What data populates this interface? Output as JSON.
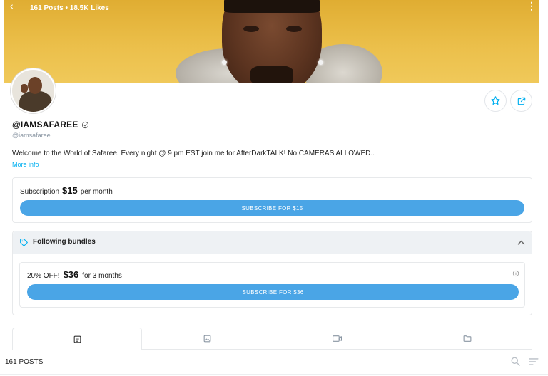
{
  "header": {
    "stats": "161 Posts • 18.5K Likes",
    "back_icon": "back-arrow-icon",
    "more_icon": "more-vertical-icon"
  },
  "profile": {
    "display_name": "@IAMSAFAREE",
    "username": "@iamsafaree",
    "bio": "Welcome to the World of Safaree. Every night @ 9 pm EST join me for AfterDarkTALK! No CAMERAS ALLOWED..",
    "more_info": "More info",
    "verified_icon": "verified-icon",
    "favorite_icon": "star-icon",
    "share_icon": "share-icon"
  },
  "subscription": {
    "label": "Subscription",
    "price": "$15",
    "period": "per month",
    "button": "SUBSCRIBE FOR $15"
  },
  "bundles": {
    "title": "Following bundles",
    "items": [
      {
        "discount": "20% OFF!",
        "price": "$36",
        "duration": "for 3 months",
        "button": "SUBSCRIBE FOR $36"
      }
    ]
  },
  "tabs": [
    {
      "icon": "posts-icon",
      "active": true
    },
    {
      "icon": "image-icon",
      "active": false
    },
    {
      "icon": "video-icon",
      "active": false
    },
    {
      "icon": "folder-icon",
      "active": false
    }
  ],
  "feed": {
    "posts_count": "161 POSTS",
    "search_icon": "search-icon",
    "sort_icon": "sort-icon"
  },
  "colors": {
    "accent": "#00aff0",
    "button": "#4aa5e6",
    "cover": "#ebbf4a"
  }
}
